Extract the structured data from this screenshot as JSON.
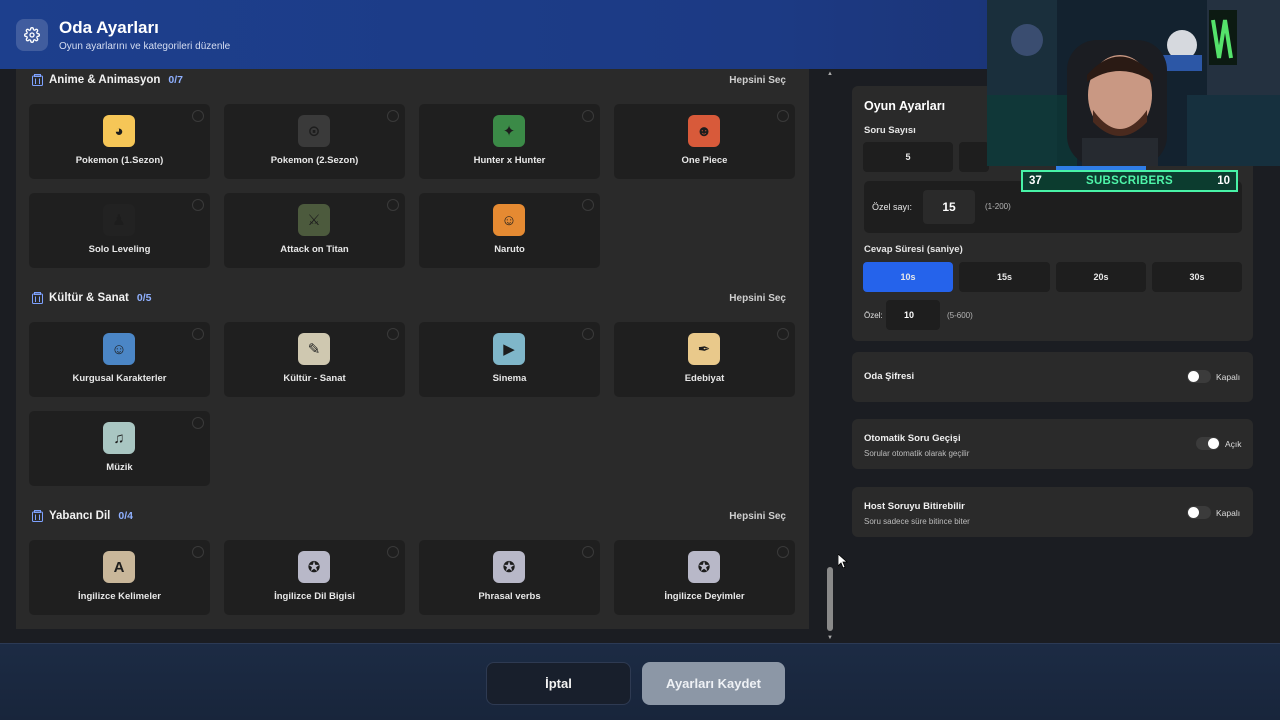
{
  "header": {
    "title": "Oda Ayarları",
    "subtitle": "Oyun ayarlarını ve kategorileri düzenle",
    "icon": "gear-icon"
  },
  "sections": [
    {
      "title": "Anime & Animasyon",
      "count": "0/7",
      "select_all": "Hepsini Seç",
      "cards": [
        {
          "label": "Pokemon (1.Sezon)",
          "thumb": "pokemon-psyduck-thumb",
          "color": "#f6c657",
          "glyph": "◕"
        },
        {
          "label": "Pokemon (2.Sezon)",
          "thumb": "pokemon-unown-thumb",
          "color": "#3a3a3a",
          "glyph": "⊙"
        },
        {
          "label": "Hunter x Hunter",
          "thumb": "hunter-x-hunter-thumb",
          "color": "#3b8a47",
          "glyph": "✦"
        },
        {
          "label": "One Piece",
          "thumb": "one-piece-thumb",
          "color": "#d85a3a",
          "glyph": "☻"
        },
        {
          "label": "Solo Leveling",
          "thumb": "solo-leveling-thumb",
          "color": "#222222",
          "glyph": "♟"
        },
        {
          "label": "Attack on Titan",
          "thumb": "attack-on-titan-thumb",
          "color": "#4c5a3d",
          "glyph": "⚔"
        },
        {
          "label": "Naruto",
          "thumb": "naruto-thumb",
          "color": "#e58a32",
          "glyph": "☺"
        }
      ]
    },
    {
      "title": "Kültür & Sanat",
      "count": "0/5",
      "select_all": "Hepsini Seç",
      "cards": [
        {
          "label": "Kurgusal Karakterler",
          "thumb": "fictional-characters-thumb",
          "color": "#4b86c6",
          "glyph": "☺"
        },
        {
          "label": "Kültür - Sanat",
          "thumb": "culture-art-thumb",
          "color": "#cfc8b0",
          "glyph": "✎"
        },
        {
          "label": "Sinema",
          "thumb": "cinema-thumb",
          "color": "#7fb6c9",
          "glyph": "▶"
        },
        {
          "label": "Edebiyat",
          "thumb": "literature-thumb",
          "color": "#e9c98b",
          "glyph": "✒"
        },
        {
          "label": "Müzik",
          "thumb": "music-thumb",
          "color": "#a9c6c2",
          "glyph": "♫"
        }
      ]
    },
    {
      "title": "Yabancı Dil",
      "count": "0/4",
      "select_all": "Hepsini Seç",
      "cards": [
        {
          "label": "İngilizce Kelimeler",
          "thumb": "english-words-thumb",
          "color": "#c9b79a",
          "glyph": "A"
        },
        {
          "label": "İngilizce Dil Bigisi",
          "thumb": "english-grammar-thumb",
          "color": "#b8b8c8",
          "glyph": "✪"
        },
        {
          "label": "Phrasal verbs",
          "thumb": "phrasal-verbs-thumb",
          "color": "#b8b8c8",
          "glyph": "✪"
        },
        {
          "label": "İngilizce Deyimler",
          "thumb": "english-idioms-thumb",
          "color": "#b8b8c8",
          "glyph": "✪"
        }
      ]
    }
  ],
  "game_settings": {
    "title": "Oyun Ayarları",
    "question_count_label": "Soru Sayısı",
    "question_count_options": [
      "5"
    ],
    "custom_count_label": "Özel sayı:",
    "custom_count_value": "15",
    "custom_count_hint": "(1-200)",
    "answer_time_label": "Cevap Süresi (saniye)",
    "answer_time_options": [
      "10s",
      "15s",
      "20s",
      "30s"
    ],
    "answer_time_selected": "10s",
    "custom_time_label": "Özel:",
    "custom_time_value": "10",
    "custom_time_hint": "(5-600)"
  },
  "settings": [
    {
      "name": "Oda Şifresi",
      "desc": "",
      "state": "Kapalı",
      "on": false
    },
    {
      "name": "Otomatik Soru Geçişi",
      "desc": "Sorular otomatik olarak geçilir",
      "state": "Açık",
      "on": true
    },
    {
      "name": "Host Soruyu Bitirebilir",
      "desc": "Soru sadece süre bitince biter",
      "state": "Kapalı",
      "on": false
    }
  ],
  "footer": {
    "cancel_label": "İptal",
    "save_label": "Ayarları Kaydet"
  },
  "overlay": {
    "subs_left": "37",
    "subs_label": "SUBSCRIBERS",
    "subs_right": "10"
  },
  "colors": {
    "accent": "#2563eb",
    "header": "#1d3f8d",
    "subs_green": "#48f3a7"
  }
}
